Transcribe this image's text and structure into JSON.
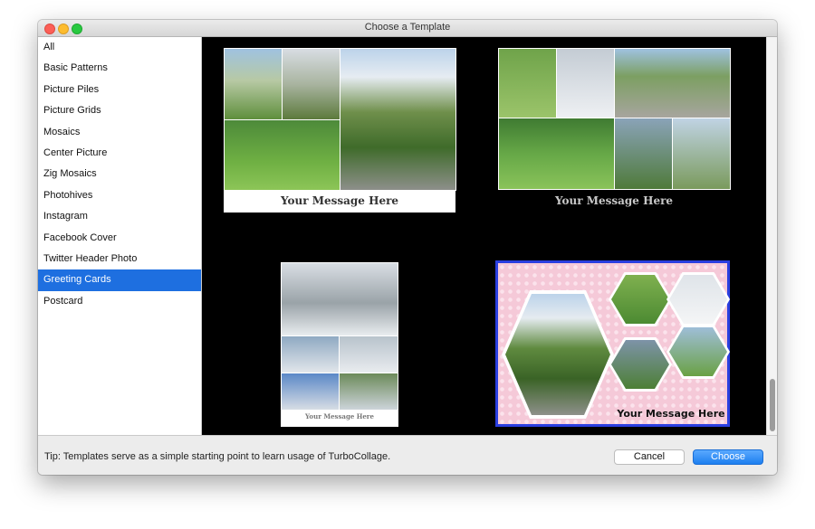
{
  "window": {
    "title": "Choose a Template"
  },
  "sidebar": {
    "items": [
      {
        "label": "All"
      },
      {
        "label": "Basic Patterns"
      },
      {
        "label": "Picture Piles"
      },
      {
        "label": "Picture Grids"
      },
      {
        "label": "Mosaics"
      },
      {
        "label": "Center Picture"
      },
      {
        "label": "Zig Mosaics"
      },
      {
        "label": "Photohives"
      },
      {
        "label": "Instagram"
      },
      {
        "label": "Facebook Cover"
      },
      {
        "label": "Twitter Header Photo"
      },
      {
        "label": "Greeting Cards"
      },
      {
        "label": "Postcard"
      }
    ],
    "selected": "Greeting Cards"
  },
  "templates": {
    "t1": {
      "message": "Your Message Here"
    },
    "t2": {
      "message": "Your Message Here"
    },
    "t3": {
      "message": "Your Message Here"
    },
    "t4": {
      "message": "Your Message Here",
      "selected": true
    }
  },
  "footer": {
    "tip": "Tip: Templates serve as a simple starting point to learn usage of TurboCollage.",
    "cancel_label": "Cancel",
    "choose_label": "Choose"
  },
  "colors": {
    "accent": "#1e6fe0",
    "selection_border": "#2a3fe0",
    "card_pink": "#f5c9d8"
  }
}
